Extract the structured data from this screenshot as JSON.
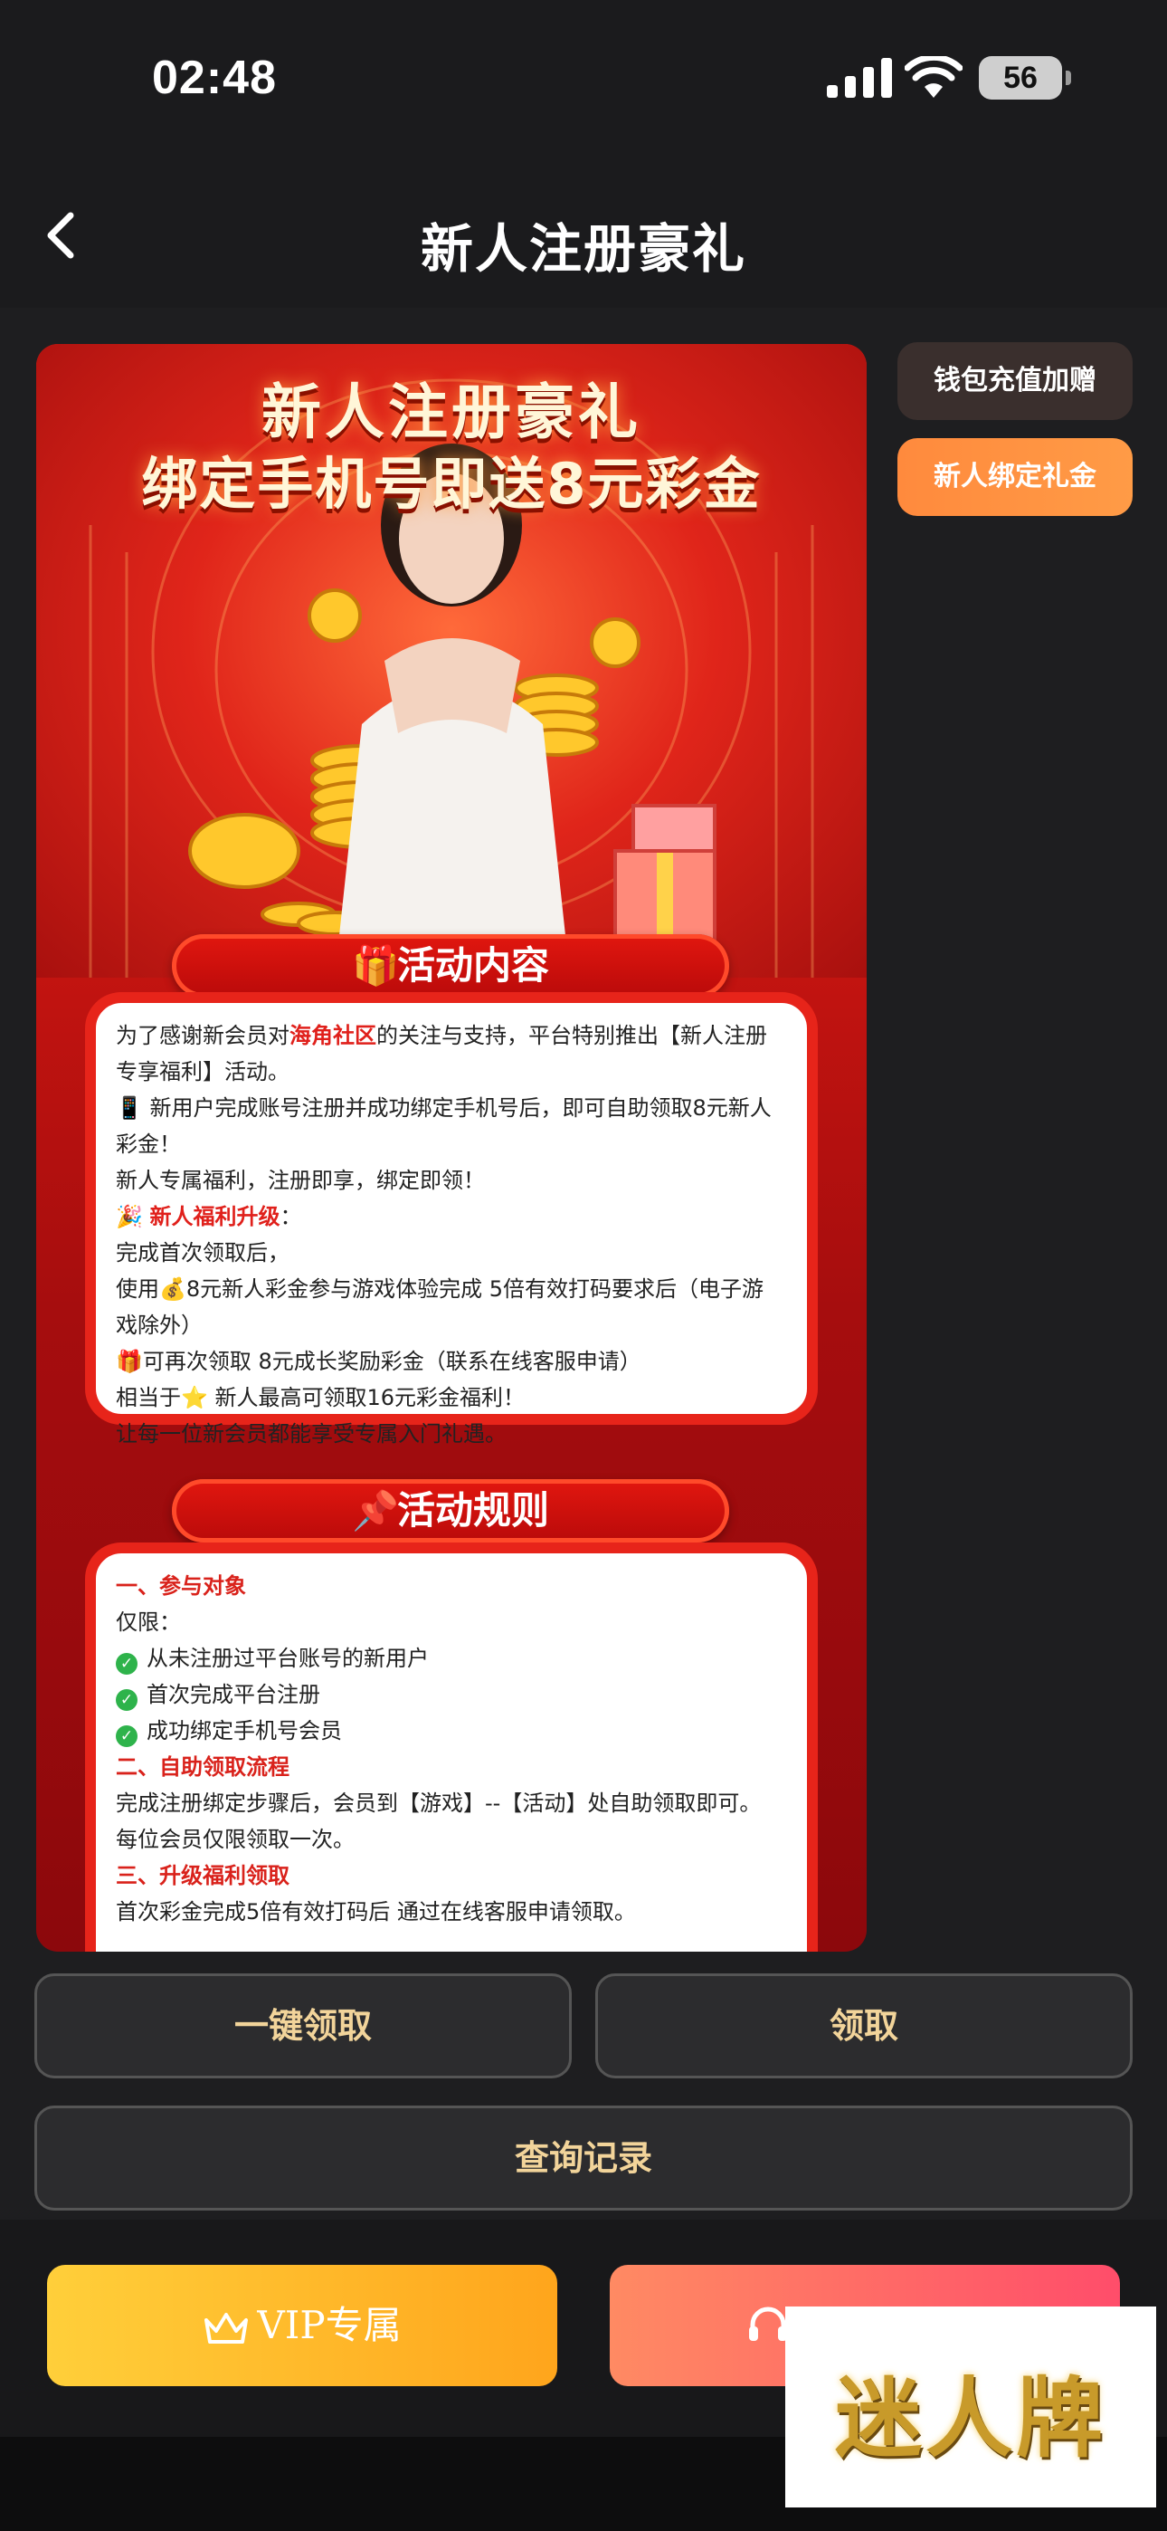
{
  "status": {
    "time": "02:48",
    "battery": "56"
  },
  "nav": {
    "title": "新人注册豪礼"
  },
  "banner": {
    "title1": "新人注册豪礼",
    "title2": "绑定手机号即送8元彩金",
    "activity_header": "活动内容",
    "activity_icon": "🎁",
    "rules_header": "活动规则",
    "rules_icon": "📌",
    "activity": {
      "p1a": "为了感谢新会员对",
      "p1b": "海角社区",
      "p1c": "的关注与支持，平台特别推出【新人注册",
      "p2": "专享福利】活动。",
      "p3": "📱 新用户完成账号注册并成功绑定手机号后，即可自助领取8元新人",
      "p4": "彩金！",
      "p5": "新人专属福利，注册即享，绑定即领！",
      "p6icon": "🎉",
      "p6": "新人福利升级",
      "p6colon": "：",
      "p7": "完成首次领取后，",
      "p8": "使用💰8元新人彩金参与游戏体验完成 5倍有效打码要求后（电子游",
      "p9": "戏除外）",
      "p10": "🎁可再次领取 8元成长奖励彩金（联系在线客服申请）",
      "p11": "相当于⭐ 新人最高可领取16元彩金福利！",
      "p12": "让每一位新会员都能享受专属入门礼遇。"
    },
    "rules": {
      "s1": "一、参与对象",
      "only": "仅限：",
      "c1": "从未注册过平台账号的新用户",
      "c2": "首次完成平台注册",
      "c3": "成功绑定手机号会员",
      "s2": "二、自助领取流程",
      "r1": "完成注册绑定步骤后，会员到【游戏】--【活动】处自助领取即可。",
      "r2": "每位会员仅限领取一次。",
      "s3": "三、升级福利领取",
      "r3": "首次彩金完成5倍有效打码后 通过在线客服申请领取。"
    }
  },
  "side_tabs": [
    "钱包充值加赠",
    "新人绑定礼金"
  ],
  "actions": {
    "one_click": "一键领取",
    "claim": "领取",
    "records": "查询记录"
  },
  "bottom": {
    "vip": "VIP专属"
  },
  "watermark": "迷人牌",
  "colors": {
    "accent_orange": "#ff9040",
    "gold_text": "#f2d49a",
    "red": "#e0201b"
  }
}
